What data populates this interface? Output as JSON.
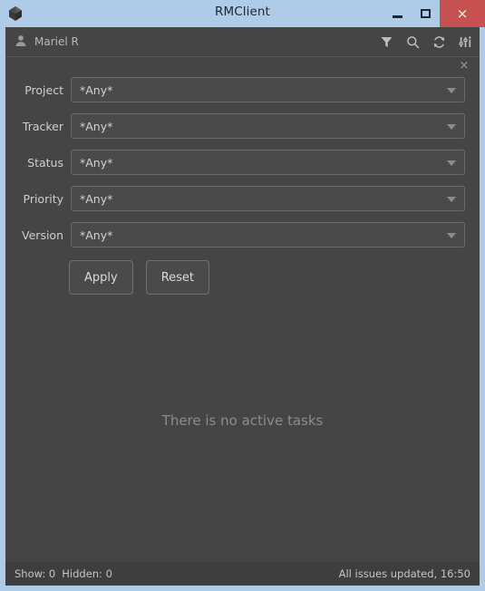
{
  "window": {
    "title": "RMClient",
    "app_icon": "cube-icon",
    "controls": {
      "minimize": "–",
      "maximize": "□",
      "close": "×"
    },
    "colors": {
      "titlebar": "#aecbe8",
      "close_button": "#c75050",
      "client_background": "#454545",
      "statusbar": "#3e3e3e",
      "field_background": "#4a4a4a",
      "field_border": "#6a6a6a",
      "text_primary": "#d2d2d2",
      "text_muted": "#8c8c8c"
    }
  },
  "toolbar": {
    "user_icon": "user-icon",
    "user_name": "Mariel R",
    "actions": [
      {
        "name": "filter-icon",
        "title": "Filter"
      },
      {
        "name": "search-icon",
        "title": "Search"
      },
      {
        "name": "refresh-icon",
        "title": "Refresh"
      },
      {
        "name": "settings-sliders-icon",
        "title": "Settings"
      }
    ]
  },
  "filter_panel": {
    "close_label": "×",
    "fields": [
      {
        "label": "Project",
        "value": "*Any*"
      },
      {
        "label": "Tracker",
        "value": "*Any*"
      },
      {
        "label": "Status",
        "value": "*Any*"
      },
      {
        "label": "Priority",
        "value": "*Any*"
      },
      {
        "label": "Version",
        "value": "*Any*"
      }
    ],
    "apply_label": "Apply",
    "reset_label": "Reset"
  },
  "task_area": {
    "empty_message": "There is no active tasks"
  },
  "statusbar": {
    "show_label": "Show: 0",
    "hidden_label": "Hidden: 0",
    "update_status": "All issues updated, 16:50"
  }
}
